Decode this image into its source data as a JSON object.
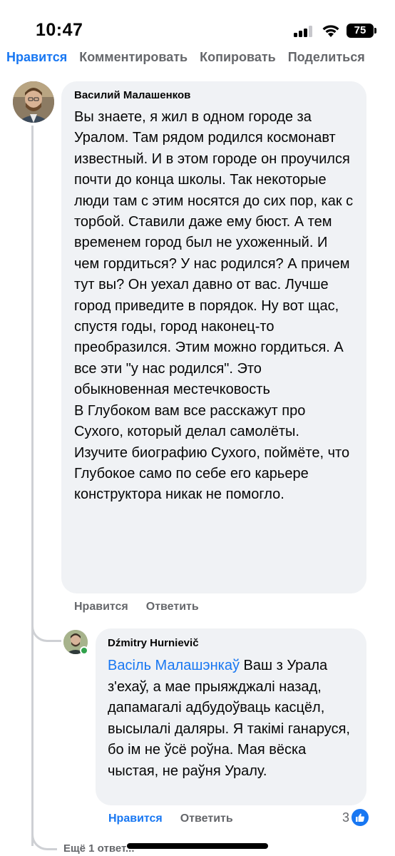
{
  "status_bar": {
    "time": "10:47",
    "battery_level": "75",
    "icons": [
      "signal-icon",
      "wifi-icon",
      "battery-icon"
    ]
  },
  "top_actions": {
    "like": "Нравится",
    "comment": "Комментировать",
    "copy": "Копировать",
    "share": "Поделиться"
  },
  "comment1": {
    "author": "Василий Малашенков",
    "text_lines": [
      "Вы знаете, я жил в одном городе за Уралом. Там рядом родился космонавт известный. И в этом городе он проучился почти до конца школы. Так некоторые люди там с этим носятся до сих пор, как с торбой. Ставили даже ему бюст. А тем временем город был не ухоженный. И чем гордиться? У нас родился? А причем тут вы? Он уехал давно от вас. Лучше город приведите в порядок. Ну вот щас, спустя годы, город наконец-то преобразился. Этим можно гордиться. А все эти \"у нас родился\". Это обыкновенная местечковость",
      "В Глубоком вам все расскажут про Сухого, который делал самолёты. Изучите биографию Сухого, поймёте, что Глубокое само по себе его карьере конструктора никак не помогло."
    ],
    "like_label": "Нравится",
    "reply_label": "Ответить"
  },
  "reply1": {
    "author": "Dźmitry Hurnievič",
    "mention": "Васіль Малашэнкаў",
    "text": " Ваш з Урала з'ехаў, а мае прыяжджалі назад, дапамагалі адбудоўваць касцёл, высылалі даляры. Я такімі ганаруся, бо ім не ўсё роўна. Мая вёска чыстая, не раўня Уралу.",
    "like_label": "Нравится",
    "reply_label": "Ответить",
    "reaction_count": "3",
    "like_state": "active"
  },
  "more_replies": "Ещё 1 ответ...",
  "colors": {
    "accent": "#1877f2",
    "muted": "#65676b",
    "bubble": "#f0f2f5",
    "online": "#31a24c"
  }
}
